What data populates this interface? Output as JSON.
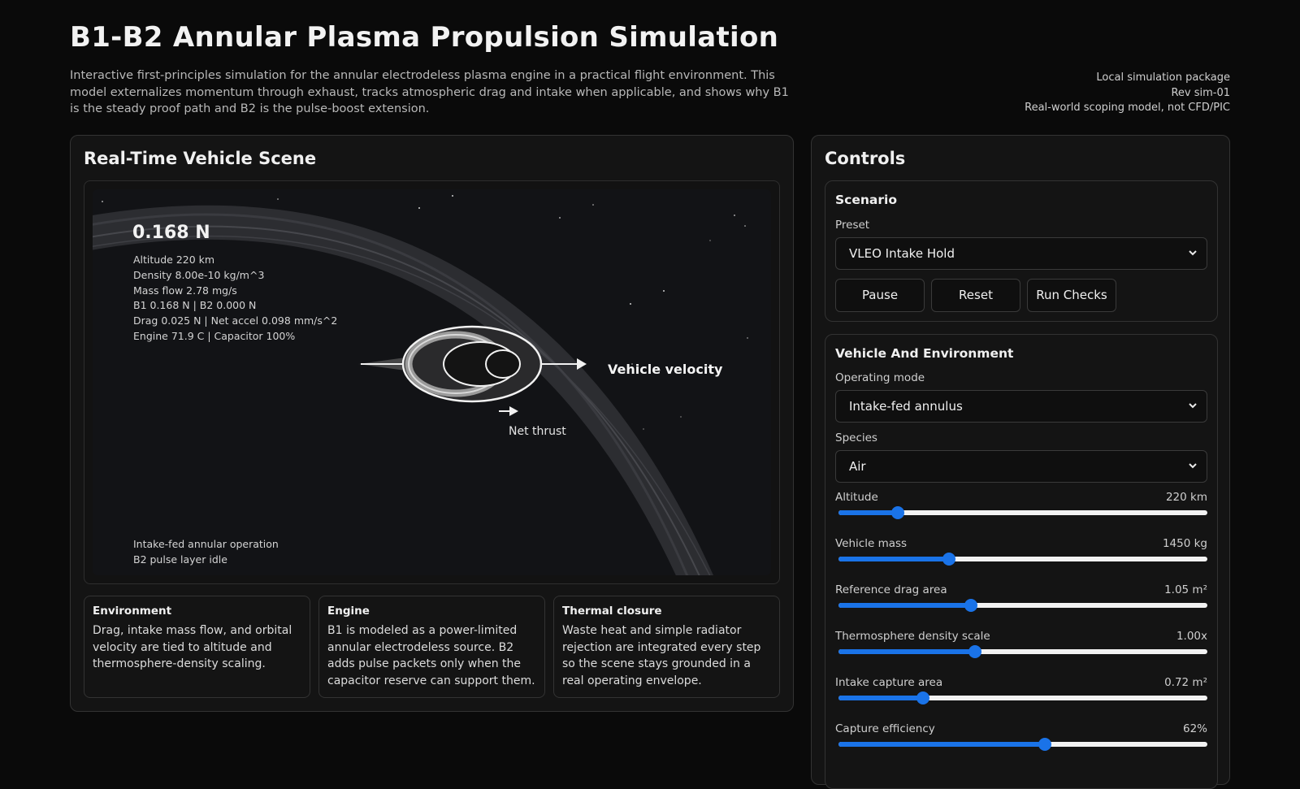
{
  "header": {
    "title": "B1-B2 Annular Plasma Propulsion Simulation",
    "intro": "Interactive first-principles simulation for the annular electrodeless plasma engine in a practical flight environment. This model externalizes momentum through exhaust, tracks atmospheric drag and intake when applicable, and shows why B1 is the steady proof path and B2 is the pulse-boost extension.",
    "meta": [
      "Local simulation package",
      "Rev sim-01",
      "Real-world scoping model, not CFD/PIC"
    ]
  },
  "scene": {
    "title": "Real-Time Vehicle Scene",
    "thrust": "0.168 N",
    "hud": [
      "Altitude 220 km",
      "Density 8.00e-10 kg/m^3",
      "Mass flow 2.78 mg/s",
      "B1 0.168 N  |  B2 0.000 N",
      "Drag 0.025 N  |  Net accel 0.098 mm/s^2",
      "Engine 71.9 C  |  Capacitor 100%"
    ],
    "footer": [
      "Intake-fed annular operation",
      "B2 pulse layer idle"
    ],
    "velocity_label": "Vehicle velocity",
    "net_thrust_label": "Net thrust"
  },
  "cards": [
    {
      "title": "Environment",
      "body": "Drag, intake mass flow, and orbital velocity are tied to altitude and thermosphere-density scaling."
    },
    {
      "title": "Engine",
      "body": "B1 is modeled as a power-limited annular electrodeless source. B2 adds pulse packets only when the capacitor reserve can support them."
    },
    {
      "title": "Thermal closure",
      "body": "Waste heat and simple radiator rejection are integrated every step so the scene stays grounded in a real operating envelope."
    }
  ],
  "controls": {
    "title": "Controls",
    "scenario": {
      "title": "Scenario",
      "preset_label": "Preset",
      "preset_value": "VLEO Intake Hold",
      "buttons": [
        "Pause",
        "Reset",
        "Run Checks"
      ]
    },
    "vehicle": {
      "title": "Vehicle And Environment",
      "mode_label": "Operating mode",
      "mode_value": "Intake-fed annulus",
      "species_label": "Species",
      "species_value": "Air",
      "sliders": [
        {
          "label": "Altitude",
          "value": "220 km",
          "fraction": 0.16
        },
        {
          "label": "Vehicle mass",
          "value": "1450 kg",
          "fraction": 0.3
        },
        {
          "label": "Reference drag area",
          "value": "1.05 m²",
          "fraction": 0.36
        },
        {
          "label": "Thermosphere density scale",
          "value": "1.00x",
          "fraction": 0.37
        },
        {
          "label": "Intake capture area",
          "value": "0.72 m²",
          "fraction": 0.23
        },
        {
          "label": "Capture efficiency",
          "value": "62%",
          "fraction": 0.56
        }
      ]
    }
  },
  "colors": {
    "accent": "#1a73e8",
    "background": "#0a0a0a",
    "panel": "#141414"
  }
}
